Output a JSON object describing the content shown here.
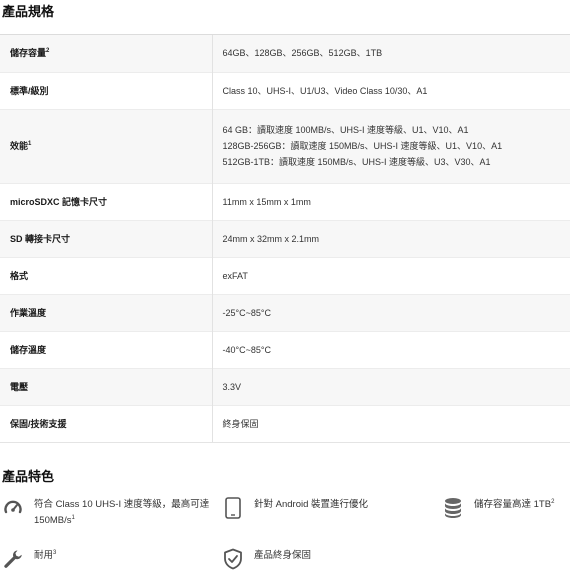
{
  "specs": {
    "title": "產品規格",
    "rows": [
      {
        "label": "儲存容量",
        "sup": "2",
        "lines": [
          "64GB、128GB、256GB、512GB、1TB"
        ]
      },
      {
        "label": "標準/級別",
        "sup": "",
        "lines": [
          "Class 10、UHS-I、U1/U3、Video Class 10/30、A1"
        ]
      },
      {
        "label": "效能",
        "sup": "1",
        "lines": [
          "64 GB：讀取速度 100MB/s、UHS-I 速度等級、U1、V10、A1",
          "128GB-256GB：讀取速度 150MB/s、UHS-I 速度等級、U1、V10、A1",
          "512GB-1TB：讀取速度 150MB/s、UHS-I 速度等級、U3、V30、A1"
        ]
      },
      {
        "label": "microSDXC 記憶卡尺寸",
        "sup": "",
        "lines": [
          "11mm x 15mm x 1mm"
        ]
      },
      {
        "label": "SD 轉接卡尺寸",
        "sup": "",
        "lines": [
          "24mm x 32mm x 2.1mm"
        ]
      },
      {
        "label": "格式",
        "sup": "",
        "lines": [
          "exFAT"
        ]
      },
      {
        "label": "作業溫度",
        "sup": "",
        "lines": [
          "-25°C~85°C"
        ]
      },
      {
        "label": "儲存溫度",
        "sup": "",
        "lines": [
          "-40°C~85°C"
        ]
      },
      {
        "label": "電壓",
        "sup": "",
        "lines": [
          "3.3V"
        ]
      },
      {
        "label": "保固/技術支援",
        "sup": "",
        "lines": [
          "終身保固"
        ]
      }
    ]
  },
  "features": {
    "title": "產品特色",
    "items": [
      {
        "icon": "speedometer-icon",
        "text": "符合 Class 10 UHS-I 速度等級，最高可達 150MB/s",
        "sup": "1"
      },
      {
        "icon": "tablet-icon",
        "text": "針對 Android 裝置進行優化",
        "sup": ""
      },
      {
        "icon": "database-icon",
        "text": "儲存容量高達 1TB",
        "sup": "2"
      },
      {
        "icon": "wrench-icon",
        "text": "耐用",
        "sup": "3"
      },
      {
        "icon": "shield-check-icon",
        "text": "產品終身保固",
        "sup": ""
      }
    ]
  }
}
